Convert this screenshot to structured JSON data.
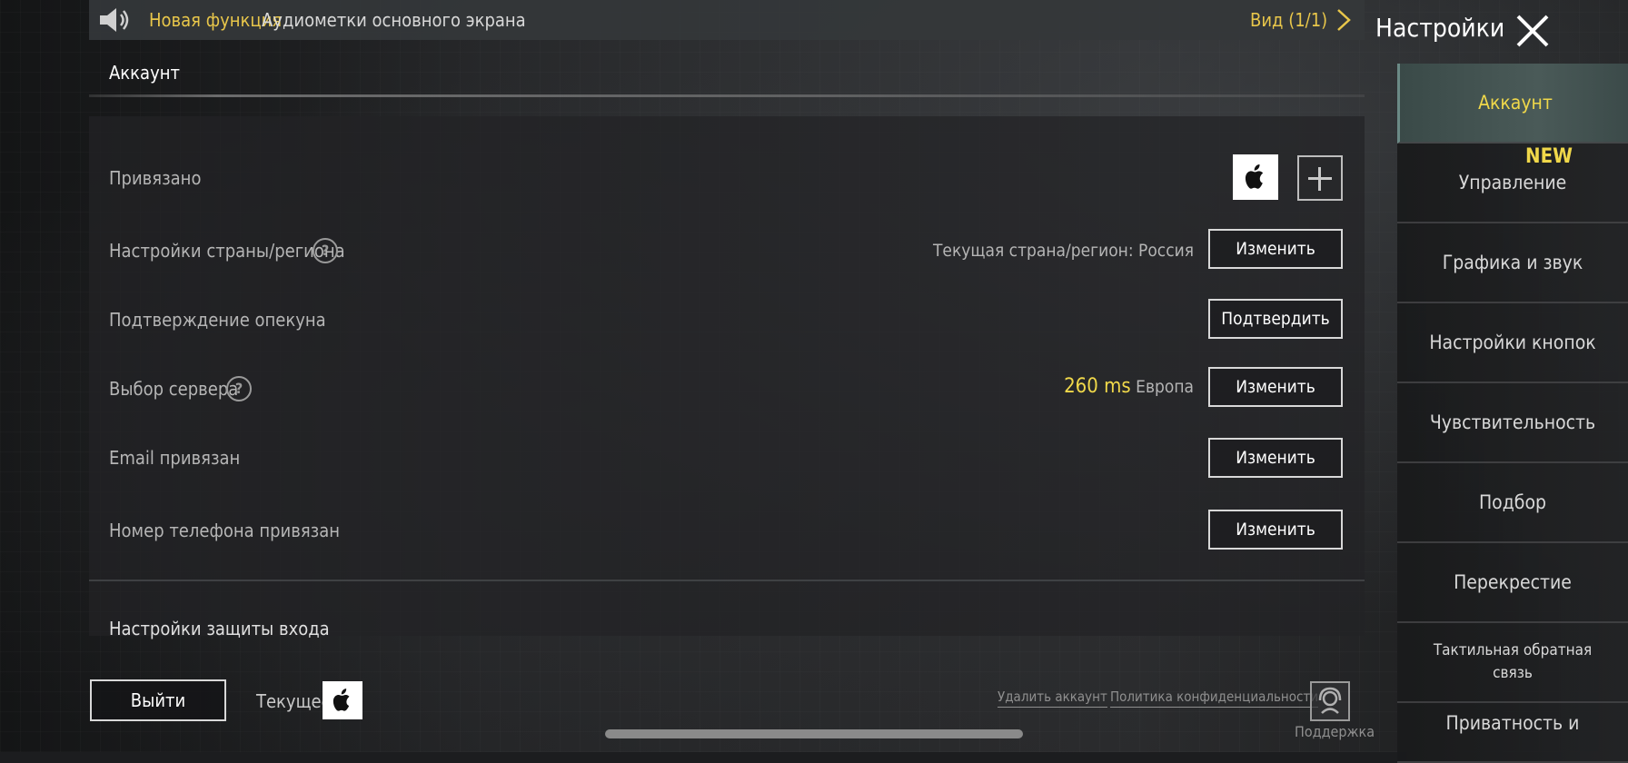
{
  "banner": {
    "new_label": "Новая функция",
    "new_text": "Аудиометки основного экрана",
    "view": "Вид (1/1)"
  },
  "section": {
    "title": "Аккаунт"
  },
  "rows": {
    "linked": {
      "label": "Привязано"
    },
    "region": {
      "label": "Настройки страны/региона",
      "value": "Текущая страна/регион: Россия",
      "button": "Изменить"
    },
    "guardian": {
      "label": "Подтверждение опекуна",
      "button": "Подтвердить"
    },
    "server": {
      "label": "Выбор сервера",
      "ping": "260 ms",
      "region_name": "Европа",
      "button": "Изменить"
    },
    "email": {
      "label": "Email привязан",
      "button": "Изменить"
    },
    "phone": {
      "label": "Номер телефона привязан",
      "button": "Изменить"
    }
  },
  "bottom_heading": "Настройки защиты входа",
  "footer": {
    "logout": "Выйти",
    "current": "Текущее",
    "delete_account": "Удалить аккаунт",
    "privacy_policy": "Политика конфиденциальности",
    "support": "Поддержка"
  },
  "sidebar": {
    "title": "Настройки",
    "new_badge": "NEW",
    "items": [
      {
        "label": "Аккаунт"
      },
      {
        "label": "Управление"
      },
      {
        "label": "Графика и звук"
      },
      {
        "label": "Настройки кнопок"
      },
      {
        "label": "Чувствительность"
      },
      {
        "label": "Подбор"
      },
      {
        "label": "Перекрестие"
      },
      {
        "label": "Тактильная обратная связь"
      },
      {
        "label": "Приватность и"
      }
    ]
  },
  "colors": {
    "accent_yellow": "#f0d84a",
    "active_tab": "#4a5a58"
  }
}
